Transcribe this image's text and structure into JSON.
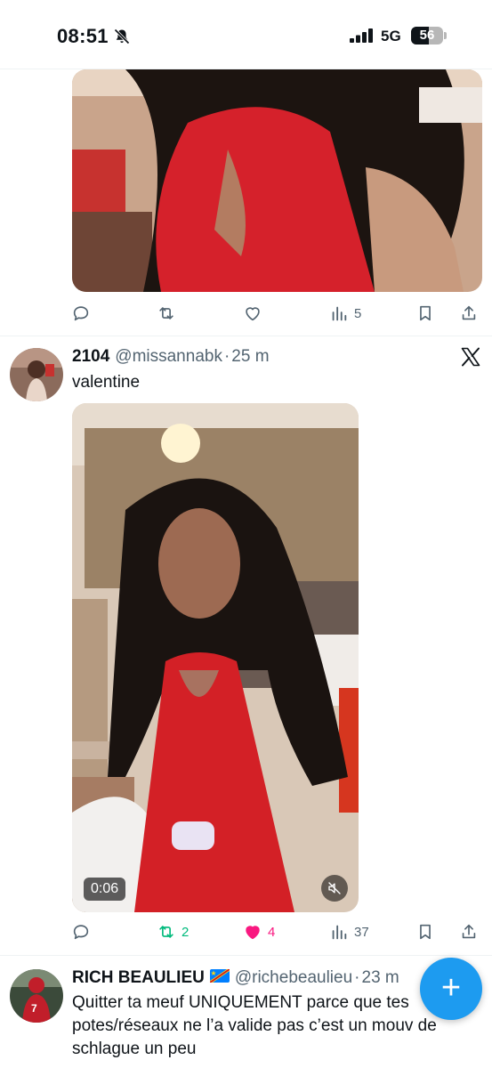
{
  "status_bar": {
    "time": "08:51",
    "network": "5G",
    "battery_level": "56",
    "battery_fraction": 0.56,
    "icons": [
      "bell-off-icon",
      "signal-icon",
      "battery-icon"
    ]
  },
  "tweets": [
    {
      "media": {
        "type": "video-still",
        "icon": "video-thumbnail"
      },
      "actions": {
        "replies": "",
        "retweets": "",
        "likes": "",
        "views": "5"
      },
      "retweeted": false,
      "liked": false
    },
    {
      "name": "2104",
      "handle": "@missannabk",
      "separator": "·",
      "time_ago": "25 m",
      "text": "valentine",
      "media": {
        "type": "video",
        "duration": "0:06",
        "muted": true
      },
      "actions": {
        "replies": "",
        "retweets": "2",
        "likes": "4",
        "views": "37"
      },
      "retweeted": true,
      "liked": true
    },
    {
      "name": "RICH BEAULIEU",
      "handle": "@richebeaulieu",
      "separator": "·",
      "time_ago": "23 m",
      "text_lines": [
        "Quitter ta meuf UNIQUEMENT parce que tes",
        "potes/réseaux ne l’a valide pas c’est un mouv de",
        "schlague un peu"
      ]
    }
  ],
  "fab": {
    "label": "+"
  },
  "colors": {
    "accent": "#1d9bf0",
    "retweet": "#00ba7c",
    "like": "#f91880",
    "text": "#0f1419",
    "muted": "#536471"
  }
}
